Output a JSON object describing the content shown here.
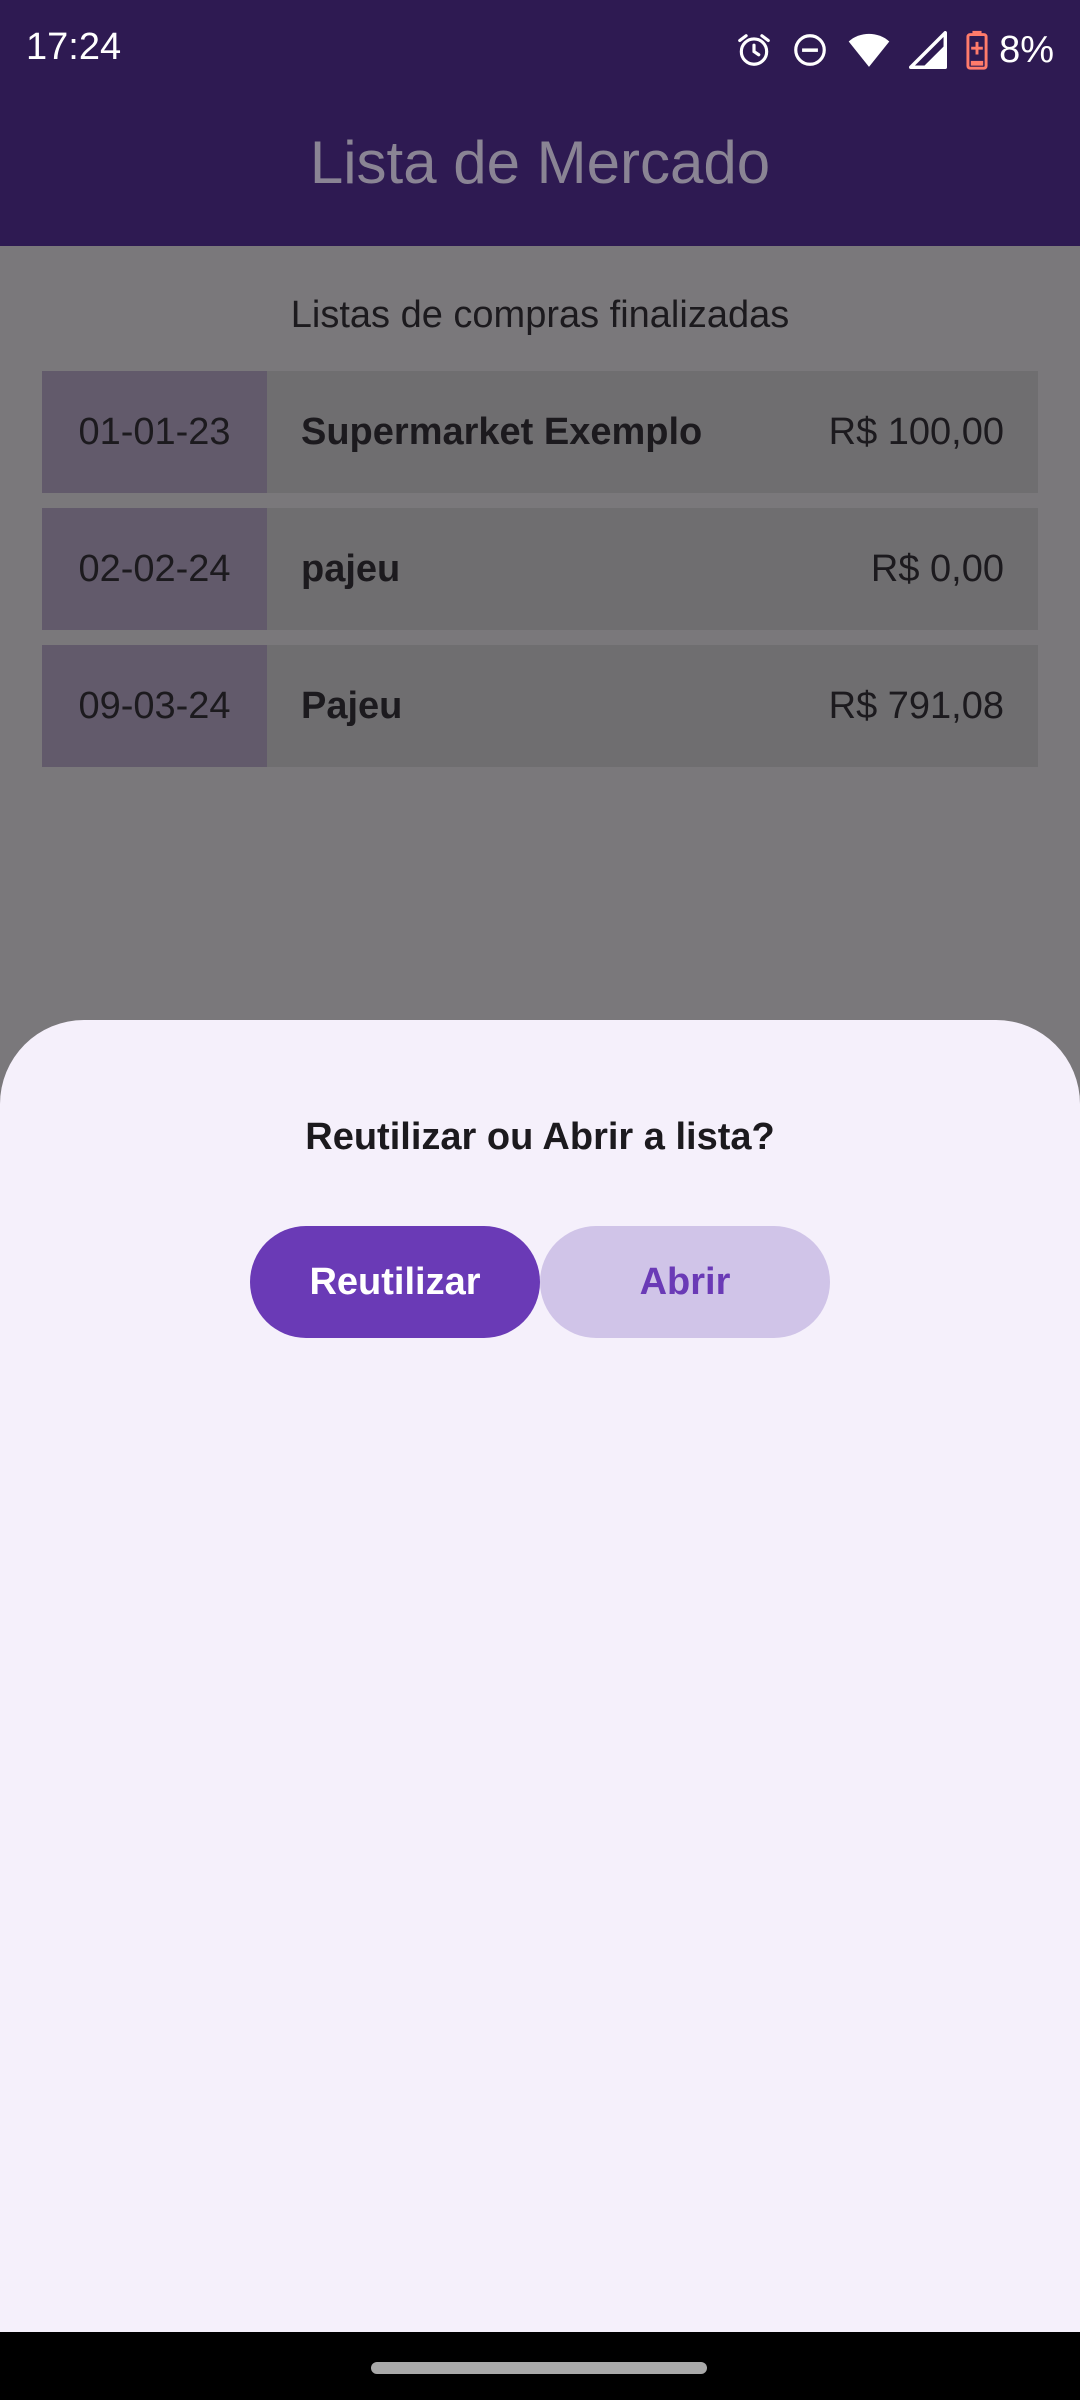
{
  "status_bar": {
    "time": "17:24",
    "battery_percent": "8%",
    "icons": [
      "alarm-icon",
      "do-not-disturb-icon",
      "wifi-icon",
      "signal-icon",
      "battery-icon"
    ]
  },
  "app_bar": {
    "title": "Lista de Mercado"
  },
  "content": {
    "section_title": "Listas de compras finalizadas",
    "lists": [
      {
        "date": "01-01-23",
        "store": "Supermarket Exemplo",
        "total": "R$ 100,00"
      },
      {
        "date": "02-02-24",
        "store": "pajeu",
        "total": "R$ 0,00"
      },
      {
        "date": "09-03-24",
        "store": "Pajeu",
        "total": "R$ 791,08"
      }
    ]
  },
  "bottom_sheet": {
    "title": "Reutilizar ou Abrir a lista?",
    "reuse_label": "Reutilizar",
    "open_label": "Abrir"
  },
  "colors": {
    "app_bar": "#2e1a52",
    "primary": "#6a3ab6",
    "secondary_container": "#d0c4e8",
    "sheet_background": "#f5f0fb",
    "battery_low": "#ff7b6b"
  }
}
